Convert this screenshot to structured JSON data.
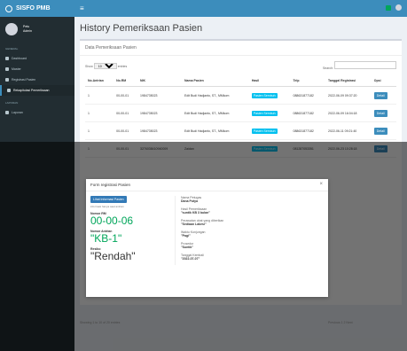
{
  "brand": "SISFO PMB",
  "user": {
    "role": "Petu",
    "name": "Admin"
  },
  "menu_sections": [
    "GENERAL",
    "LAPORAN"
  ],
  "menu_items": [
    "Dashboard",
    "Master",
    "Registrasi Pasien",
    "Rekapitulasi Pemeriksaan",
    "Laporan"
  ],
  "page_title": "History Pemeriksaan Pasien",
  "box_title": "Data Pemeriksaan Pasien",
  "table_controls": {
    "show": "Show",
    "entries_value": "10",
    "entries": "entries",
    "search": "Search:"
  },
  "table": {
    "headers": [
      "No.Antrian",
      "No.RM",
      "NIK",
      "Nama Pasien",
      "Hasil",
      "Telp",
      "Tanggal Registrasi",
      "Opsi"
    ],
    "rows": [
      [
        "1",
        "00-00-01",
        "1984735023",
        "Edit Budi Hadjanto, ST., MMkom",
        "Pasien Sembuh",
        "088631877182",
        "2022-06-09 09:37:20",
        "Detail"
      ],
      [
        "1",
        "00-00-01",
        "1984735023",
        "Edit Budi Hadjanto, ST., MMkom",
        "Pasien Sembuh",
        "088631877182",
        "2022-06-09 16:04:18",
        "Detail"
      ],
      [
        "1",
        "00-00-01",
        "1984735023",
        "Edit Budi Hadjanto, ST., MMkom",
        "Pasien Sembuh",
        "088631877182",
        "2022-06-11 09:21:40",
        "Detail"
      ],
      [
        "1",
        "00-00-01",
        "3276038410940009",
        "Zaidan",
        "Pasien Sembuh",
        "081287053351",
        "2022-06-23 10:28:18",
        "Detail"
      ]
    ]
  },
  "footer": {
    "info": "Showing 1 to 10 of 20 entries",
    "pagination": "Previous 1 2 Next"
  },
  "modal": {
    "title": "Form registrasi Pasien",
    "button": "Lihat Informasi Pasien",
    "hint": "informasi hanya saat antrian",
    "no_rm_label": "Nomor RM",
    "no_rm": "00-00-06",
    "antrian_label": "Nomor Antrian",
    "antrian": "\"KB-1\"",
    "resiko_label": "Resiko",
    "resiko": "\"Rendah\"",
    "fields": [
      {
        "k": "Nama Petugas",
        "v": "Dana Putya"
      },
      {
        "k": "Hasil Pemeriksaan",
        "v": "\"suntik KB 3 bulan\""
      },
      {
        "k": "Perawatan obat yang diberikan",
        "v": "\"Sediaan Lakesi\""
      },
      {
        "k": "Waktu Kunjungan",
        "v": "\"Pagi\""
      },
      {
        "k": "Prosedur",
        "v": "\"Suntik\""
      },
      {
        "k": "Tanggal Kembali",
        "v": "\"2022-07-07\""
      }
    ]
  }
}
